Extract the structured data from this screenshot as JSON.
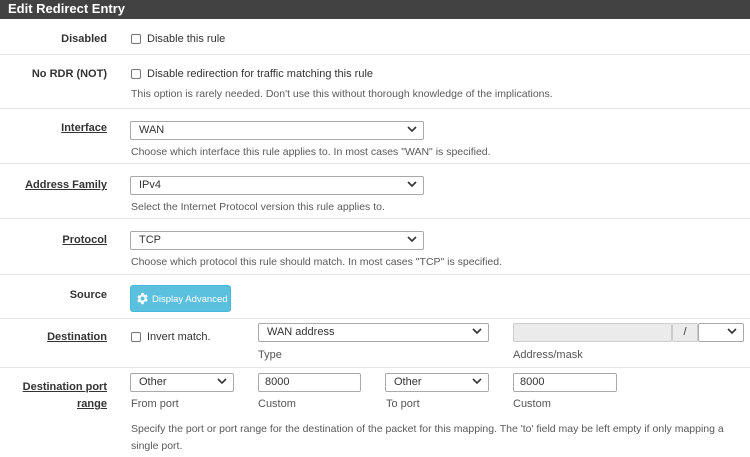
{
  "header": {
    "title": "Edit Redirect Entry"
  },
  "disabled": {
    "label": "Disabled",
    "checkbox_label": "Disable this rule"
  },
  "nordr": {
    "label": "No RDR (NOT)",
    "checkbox_label": "Disable redirection for traffic matching this rule",
    "help": "This option is rarely needed. Don't use this without thorough knowledge of the implications."
  },
  "interface": {
    "label": "Interface",
    "value": "WAN",
    "help": "Choose which interface this rule applies to. In most cases \"WAN\" is specified."
  },
  "address_family": {
    "label": "Address Family",
    "value": "IPv4",
    "help": "Select the Internet Protocol version this rule applies to."
  },
  "protocol": {
    "label": "Protocol",
    "value": "TCP",
    "help": "Choose which protocol this rule should match. In most cases \"TCP\" is specified."
  },
  "source": {
    "label": "Source",
    "button_label": "Display Advanced"
  },
  "destination": {
    "label": "Destination",
    "invert_label": "Invert match.",
    "type_value": "WAN address",
    "type_sublabel": "Type",
    "address_value": "",
    "mask_separator": "/",
    "mask_value": "",
    "address_sublabel": "Address/mask"
  },
  "dest_port": {
    "label_line1": "Destination port",
    "label_line2": "range",
    "from_select": "Other",
    "from_sublabel": "From port",
    "from_custom": "8000",
    "from_custom_sublabel": "Custom",
    "to_select": "Other",
    "to_sublabel": "To port",
    "to_custom": "8000",
    "to_custom_sublabel": "Custom",
    "help": "Specify the port or port range for the destination of the packet for this mapping. The 'to' field may be left empty if only mapping a single port."
  },
  "colors": {
    "header_bg": "#424242",
    "info_button": "#5bc0de"
  }
}
